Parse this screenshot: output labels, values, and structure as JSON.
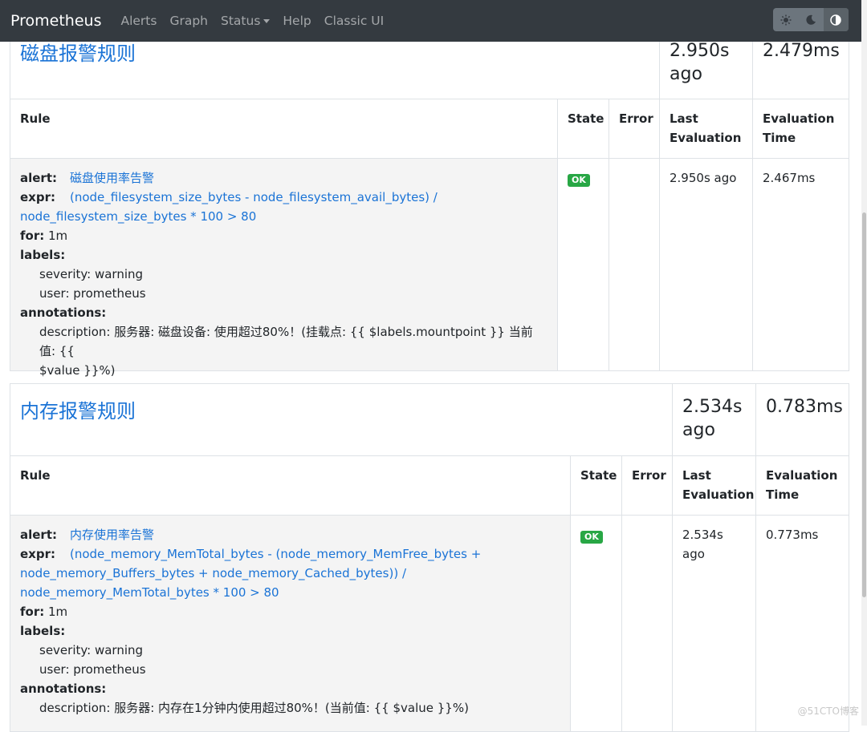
{
  "navbar": {
    "brand": "Prometheus",
    "items": [
      "Alerts",
      "Graph",
      "Status",
      "Help",
      "Classic UI"
    ],
    "theme_buttons": [
      "light-theme",
      "dark-theme",
      "browser-theme"
    ]
  },
  "groups": [
    {
      "title": "磁盘报警规则",
      "last_eval_a": "2.950s",
      "last_eval_b": "ago",
      "eval_time": "2.479ms",
      "headers": {
        "rule": "Rule",
        "state": "State",
        "error": "Error",
        "last_eval_1": "Last",
        "last_eval_2": "Evaluation",
        "eval_time_1": "Evaluation",
        "eval_time_2": "Time"
      },
      "rule": {
        "alert_key": "alert:",
        "alert": "磁盘使用率告警",
        "expr_key": "expr:",
        "expr_1": "(node_filesystem_size_bytes - node_filesystem_avail_bytes) /",
        "expr_2": "node_filesystem_size_bytes * 100 > 80",
        "for_key": "for:",
        "for": "1m",
        "labels_key": "labels:",
        "label_1": "severity: warning",
        "label_2": "user: prometheus",
        "annotations_key": "annotations:",
        "description_1": "description: 服务器: 磁盘设备: 使用超过80%！(挂载点: {{ $labels.mountpoint }} 当前值: {{",
        "description_2": "$value }}%)",
        "state": "OK",
        "last_eval": "2.950s ago",
        "eval_time": "2.467ms"
      }
    },
    {
      "title": "内存报警规则",
      "last_eval_a": "2.534s",
      "last_eval_b": "ago",
      "eval_time": "0.783ms",
      "headers": {
        "rule": "Rule",
        "state": "State",
        "error": "Error",
        "last_eval_1": "Last",
        "last_eval_2": "Evaluation",
        "eval_time_1": "Evaluation",
        "eval_time_2": "Time"
      },
      "rule": {
        "alert_key": "alert:",
        "alert": "内存使用率告警",
        "expr_key": "expr:",
        "expr_1": "(node_memory_MemTotal_bytes - (node_memory_MemFree_bytes +",
        "expr_2": "node_memory_Buffers_bytes + node_memory_Cached_bytes)) /",
        "expr_3": "node_memory_MemTotal_bytes * 100 > 80",
        "for_key": "for:",
        "for": "1m",
        "labels_key": "labels:",
        "label_1": "severity: warning",
        "label_2": "user: prometheus",
        "annotations_key": "annotations:",
        "description_1": "description: 服务器: 内存在1分钟内使用超过80%！(当前值: {{ $value }}%)",
        "state": "OK",
        "last_eval": "2.534s ago",
        "eval_time": "0.773ms"
      }
    }
  ],
  "watermark": "@51CTO博客",
  "colors": {
    "navbar_bg": "#343a40",
    "link": "#1a73d6",
    "ok_badge": "#28a745",
    "rule_bg": "#f4f4f4"
  }
}
